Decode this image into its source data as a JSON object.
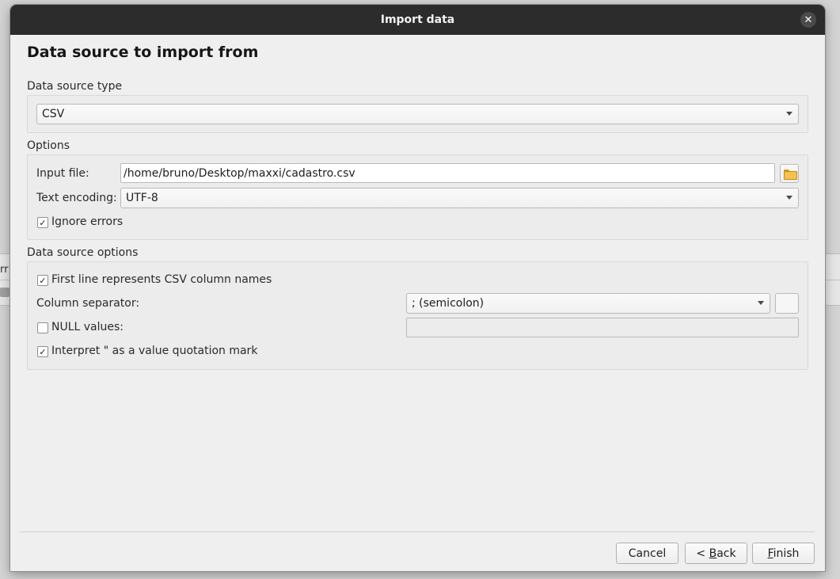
{
  "background": {
    "fragment": "rr"
  },
  "dialog": {
    "title": "Import data",
    "close_glyph": "✕",
    "page_title": "Data source to import from",
    "source_type": {
      "label": "Data source type",
      "value": "CSV"
    },
    "options": {
      "label": "Options",
      "input_file_label": "Input file:",
      "input_file_value": "/home/bruno/Desktop/maxxi/cadastro.csv",
      "encoding_label": "Text encoding:",
      "encoding_value": "UTF-8",
      "ignore_errors_label": "Ignore errors",
      "ignore_errors_checked": true
    },
    "source_options": {
      "label": "Data source options",
      "first_line_label": "First line represents CSV column names",
      "first_line_checked": true,
      "separator_label": "Column separator:",
      "separator_value": "; (semicolon)",
      "null_values_label": "NULL values:",
      "null_values_checked": false,
      "null_values_value": "",
      "interpret_quote_label": "Interpret \" as a value quotation mark",
      "interpret_quote_checked": true
    },
    "buttons": {
      "cancel": "Cancel",
      "back_prefix": "< ",
      "back_mnemonic": "B",
      "back_rest": "ack",
      "finish_mnemonic": "F",
      "finish_rest": "inish"
    },
    "check_glyph": "✓",
    "icons": {
      "folder": "folder-open-icon",
      "dropdown": "chevron-down-icon",
      "close": "close-icon"
    }
  }
}
